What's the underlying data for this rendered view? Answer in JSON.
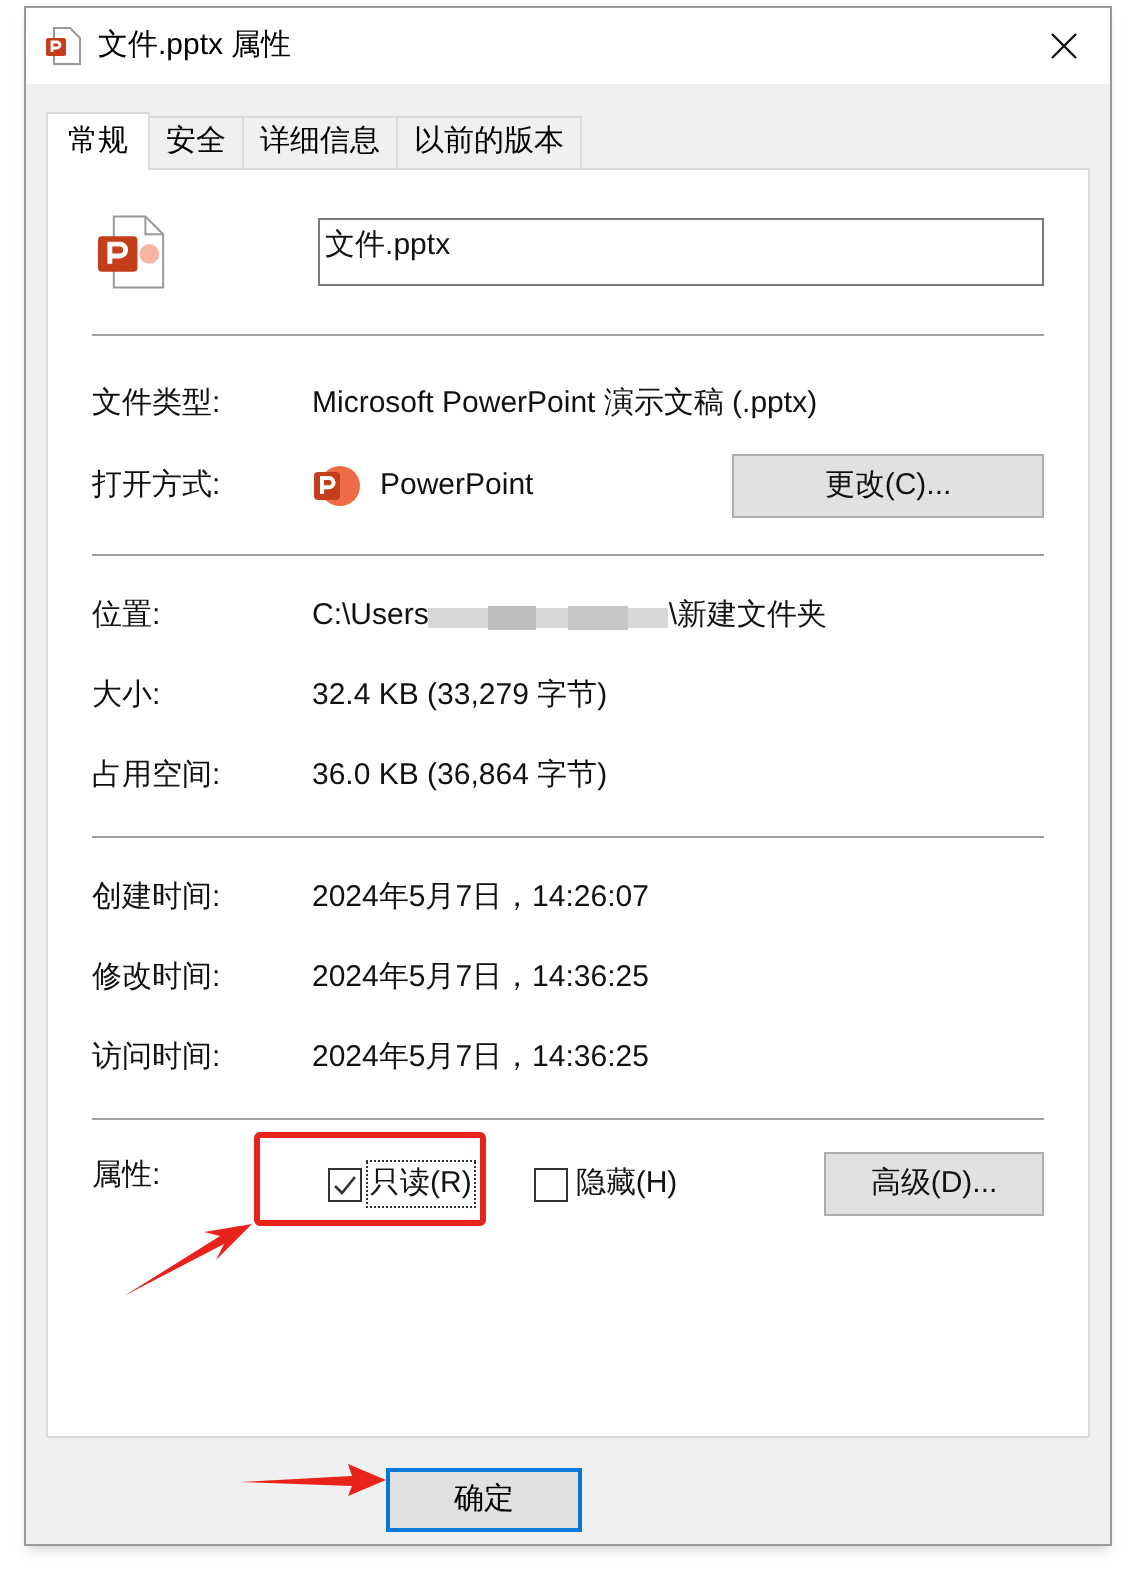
{
  "window": {
    "title": "文件.pptx 属性"
  },
  "tabs": [
    {
      "label": "常规",
      "selected": true
    },
    {
      "label": "安全",
      "selected": false
    },
    {
      "label": "详细信息",
      "selected": false
    },
    {
      "label": "以前的版本",
      "selected": false
    }
  ],
  "file_name": {
    "value": "文件.pptx"
  },
  "type_rows": [
    {
      "label": "文件类型:",
      "value": "Microsoft PowerPoint 演示文稿 (.pptx)"
    }
  ],
  "open_with": {
    "label": "打开方式:",
    "app": "PowerPoint",
    "button": "更改(C)..."
  },
  "location": {
    "label": "位置:",
    "start": "C:\\Users",
    "end": "\\新建文件夹"
  },
  "size_rows": [
    {
      "label": "大小:",
      "value": "32.4 KB (33,279 字节)"
    },
    {
      "label": "占用空间:",
      "value": "36.0 KB (36,864 字节)"
    }
  ],
  "time_rows": [
    {
      "label": "创建时间:",
      "value": "2024年5月7日，14:26:07"
    },
    {
      "label": "修改时间:",
      "value": "2024年5月7日，14:36:25"
    },
    {
      "label": "访问时间:",
      "value": "2024年5月7日，14:36:25"
    }
  ],
  "attributes": {
    "label": "属性:",
    "checkboxes": [
      {
        "label": "只读(R)",
        "checked": true,
        "focused": true
      },
      {
        "label": "隐藏(H)",
        "checked": false,
        "focused": false
      }
    ],
    "button": "高级(D)..."
  },
  "footer_buttons": [
    {
      "label": "确定",
      "default": true
    }
  ]
}
